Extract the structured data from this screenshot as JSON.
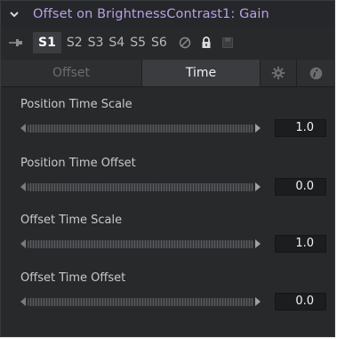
{
  "header": {
    "title": "Offset on BrightnessContrast1: Gain"
  },
  "toolbar": {
    "slots": [
      "S1",
      "S2",
      "S3",
      "S4",
      "S5",
      "S6"
    ],
    "active_slot": "S1"
  },
  "tabs": {
    "offset_label": "Offset",
    "time_label": "Time"
  },
  "controls": [
    {
      "label": "Position Time Scale",
      "value": "1.0"
    },
    {
      "label": "Position Time Offset",
      "value": "0.0"
    },
    {
      "label": "Offset Time Scale",
      "value": "1.0"
    },
    {
      "label": "Offset Time Offset",
      "value": "0.0"
    }
  ],
  "colors": {
    "title_accent": "#b7a2e4",
    "panel_bg": "#28292b",
    "active_tab_bg": "#3b3c3f"
  },
  "icons": {
    "collapse": "chevron-down-icon",
    "pin": "pin-icon",
    "disable": "circle-slash-icon",
    "lock": "lock-icon",
    "save": "save-icon",
    "settings": "gear-icon",
    "info": "info-icon"
  }
}
